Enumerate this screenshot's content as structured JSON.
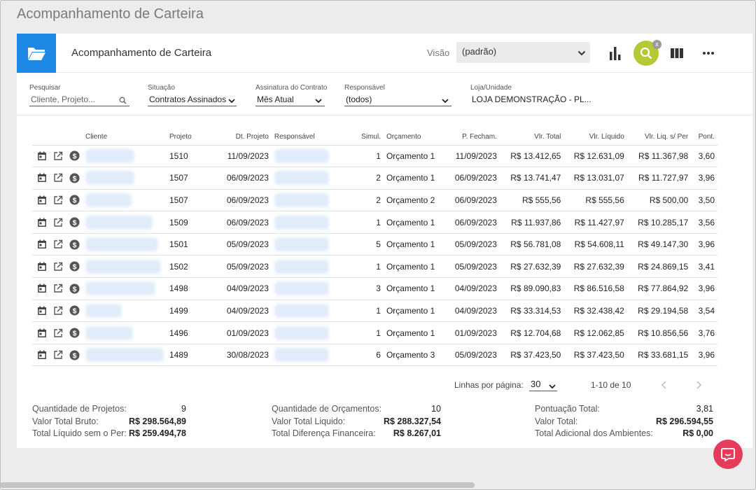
{
  "page_title": "Acompanhamento de Carteira",
  "header": {
    "title": "Acompanhamento de Carteira",
    "visao_label": "Visão",
    "visao_value": "(padrão)",
    "search_badge": "x"
  },
  "filters": {
    "pesquisar": {
      "label": "Pesquisar",
      "placeholder": "Cliente, Projeto..."
    },
    "situacao": {
      "label": "Situação",
      "value": "Contratos Assinados"
    },
    "assinatura": {
      "label": "Assinatura do Contrato",
      "value": "Mês Atual"
    },
    "responsavel": {
      "label": "Responsável",
      "value": "(todos)"
    },
    "loja": {
      "label": "Loja/Unidade",
      "value": "LOJA DEMONSTRAÇÃO - PL..."
    }
  },
  "table": {
    "columns": [
      "Cliente",
      "Projeto",
      "Dt. Projeto",
      "Responsável",
      "Simul.",
      "Orçamento",
      "P. Fecham.",
      "Vlr. Total",
      "Vlr. Líquido",
      "Vlr. Liq. s/ Per",
      "Pont."
    ],
    "rows": [
      {
        "projeto": "1510",
        "dt_projeto": "11/09/2023",
        "simul": "1",
        "orcamento": "Orçamento 1",
        "p_fecham": "11/09/2023",
        "vlr_total": "R$ 13.412,65",
        "vlr_liquido": "R$ 12.631,09",
        "vlr_liq_sper": "R$ 11.367,98",
        "pont": "3,60"
      },
      {
        "projeto": "1507",
        "dt_projeto": "06/09/2023",
        "simul": "2",
        "orcamento": "Orçamento 1",
        "p_fecham": "06/09/2023",
        "vlr_total": "R$ 13.741,47",
        "vlr_liquido": "R$ 13.031,07",
        "vlr_liq_sper": "R$ 11.727,97",
        "pont": "3,96"
      },
      {
        "projeto": "1507",
        "dt_projeto": "06/09/2023",
        "simul": "2",
        "orcamento": "Orçamento 2",
        "p_fecham": "06/09/2023",
        "vlr_total": "R$ 555,56",
        "vlr_liquido": "R$ 555,56",
        "vlr_liq_sper": "R$ 500,00",
        "pont": "3,50"
      },
      {
        "projeto": "1509",
        "dt_projeto": "06/09/2023",
        "simul": "1",
        "orcamento": "Orçamento 1",
        "p_fecham": "06/09/2023",
        "vlr_total": "R$ 11.937,86",
        "vlr_liquido": "R$ 11.427,97",
        "vlr_liq_sper": "R$ 10.285,17",
        "pont": "3,56"
      },
      {
        "projeto": "1501",
        "dt_projeto": "05/09/2023",
        "simul": "5",
        "orcamento": "Orçamento 1",
        "p_fecham": "05/09/2023",
        "vlr_total": "R$ 56.781,08",
        "vlr_liquido": "R$ 54.608,11",
        "vlr_liq_sper": "R$ 49.147,30",
        "pont": "3,96"
      },
      {
        "projeto": "1502",
        "dt_projeto": "05/09/2023",
        "simul": "1",
        "orcamento": "Orçamento 1",
        "p_fecham": "05/09/2023",
        "vlr_total": "R$ 27.632,39",
        "vlr_liquido": "R$ 27.632,39",
        "vlr_liq_sper": "R$ 24.869,15",
        "pont": "3,41"
      },
      {
        "projeto": "1498",
        "dt_projeto": "04/09/2023",
        "simul": "3",
        "orcamento": "Orçamento 1",
        "p_fecham": "04/09/2023",
        "vlr_total": "R$ 89.090,83",
        "vlr_liquido": "R$ 86.516,58",
        "vlr_liq_sper": "R$ 77.864,92",
        "pont": "3,96"
      },
      {
        "projeto": "1499",
        "dt_projeto": "04/09/2023",
        "simul": "1",
        "orcamento": "Orçamento 1",
        "p_fecham": "04/09/2023",
        "vlr_total": "R$ 33.314,53",
        "vlr_liquido": "R$ 32.438,42",
        "vlr_liq_sper": "R$ 29.194,58",
        "pont": "3,54"
      },
      {
        "projeto": "1496",
        "dt_projeto": "01/09/2023",
        "simul": "1",
        "orcamento": "Orçamento 1",
        "p_fecham": "01/09/2023",
        "vlr_total": "R$ 12.704,68",
        "vlr_liquido": "R$ 12.062,85",
        "vlr_liq_sper": "R$ 10.856,56",
        "pont": "3,76"
      },
      {
        "projeto": "1489",
        "dt_projeto": "30/08/2023",
        "simul": "6",
        "orcamento": "Orçamento 3",
        "p_fecham": "05/09/2023",
        "vlr_total": "R$ 37.423,50",
        "vlr_liquido": "R$ 37.423,50",
        "vlr_liq_sper": "R$ 33.681,15",
        "pont": "3,96"
      }
    ]
  },
  "pagination": {
    "rows_label": "Linhas por página:",
    "rows_value": "30",
    "range": "1-10 de 10"
  },
  "summary": {
    "qtd_projetos_label": "Quantidade de Projetos:",
    "qtd_projetos": "9",
    "valor_bruto_label": "Valor Total Bruto:",
    "valor_bruto": "R$ 298.564,89",
    "liquido_sem_per_label": "Total Líquido sem o Per:",
    "liquido_sem_per": "R$ 259.494,78",
    "qtd_orcamentos_label": "Quantidade de Orçamentos:",
    "qtd_orcamentos": "10",
    "valor_liquido_label": "Valor Total Liquido:",
    "valor_liquido": "R$ 288.327,54",
    "diferenca_label": "Total Diferença Financeira:",
    "diferenca": "R$ 8.267,01",
    "pontuacao_label": "Pontuação Total:",
    "pontuacao": "3,81",
    "valor_total_label": "Valor Total:",
    "valor_total": "R$ 296.594,55",
    "adicional_label": "Total Adicional dos Ambientes:",
    "adicional": "R$ 0,00"
  },
  "colors": {
    "accent": "#1e88e5",
    "link": "#2f7fc4",
    "search": "#b5c934",
    "chat": "#e53c5b"
  },
  "icons": [
    "folder-icon",
    "bar-chart-icon",
    "search-icon",
    "columns-icon",
    "more-icon",
    "calendar-icon",
    "external-link-icon",
    "dollar-icon",
    "chevron-left-icon",
    "chevron-right-icon",
    "chat-icon"
  ]
}
